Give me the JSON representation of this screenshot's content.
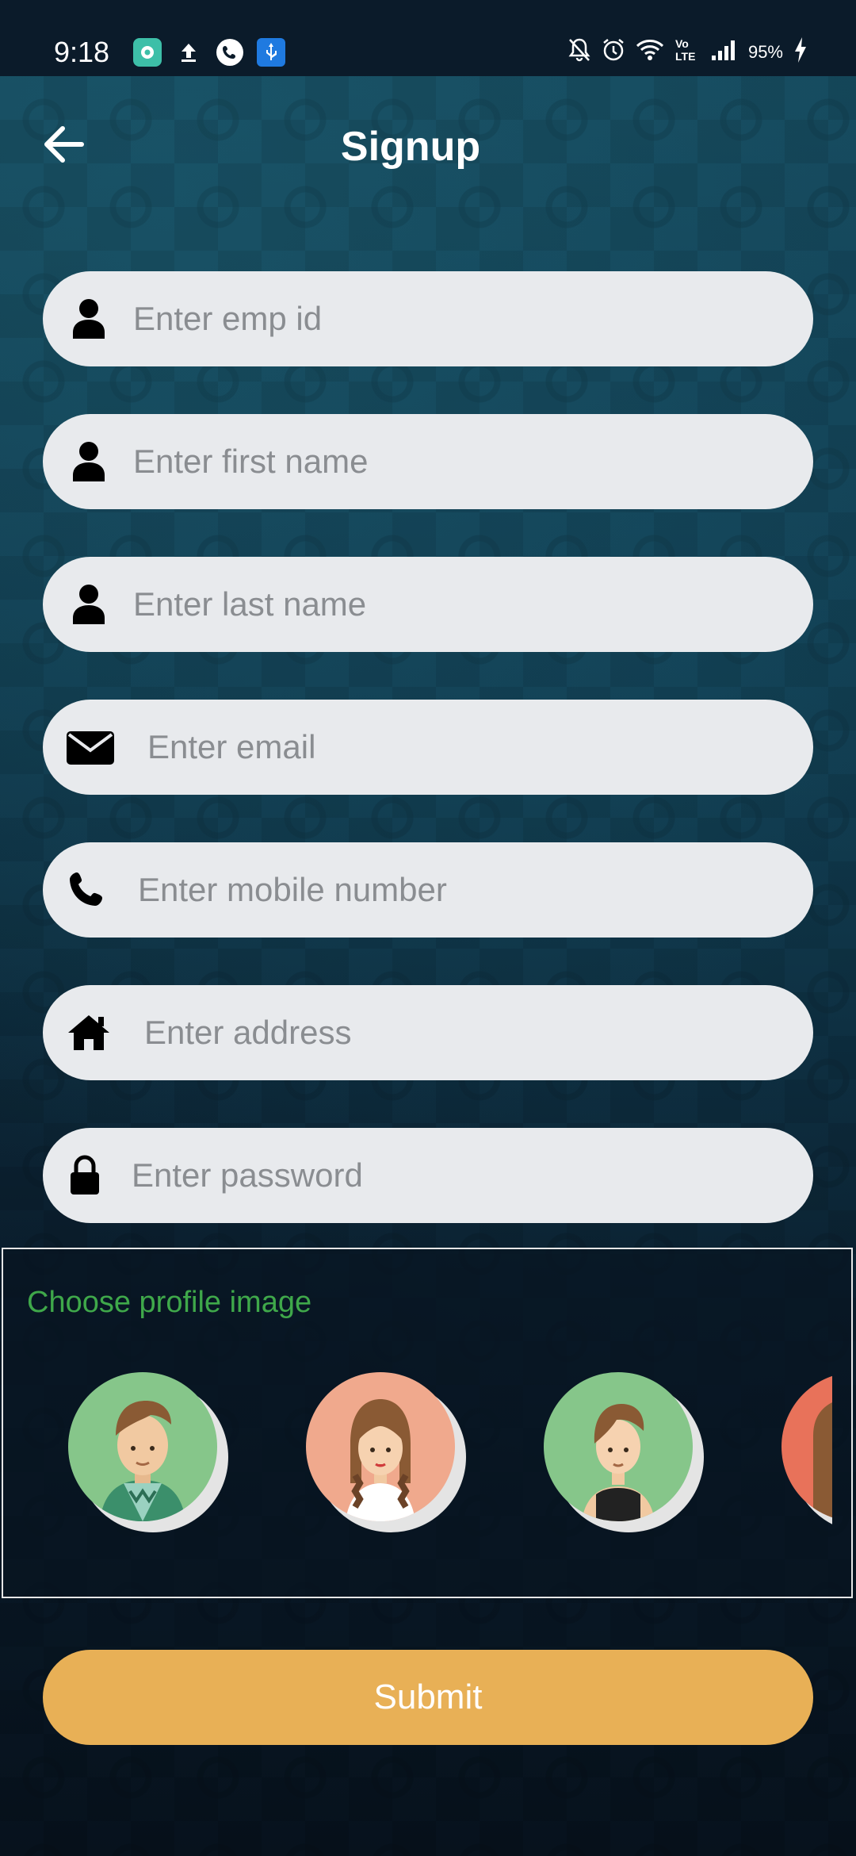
{
  "status_bar": {
    "time": "9:18",
    "battery": "95%",
    "icons_left": [
      "app-icon",
      "upload-icon",
      "phone-call-icon",
      "usb-icon"
    ],
    "icons_right": [
      "bell-off-icon",
      "alarm-icon",
      "wifi-icon",
      "volte-icon",
      "signal-icon",
      "battery-charging-icon"
    ]
  },
  "header": {
    "title": "Signup",
    "back_icon": "arrow-left-icon"
  },
  "form": {
    "emp_id": {
      "placeholder": "Enter emp id",
      "value": "",
      "icon": "person-icon"
    },
    "first_name": {
      "placeholder": "Enter first name",
      "value": "",
      "icon": "person-icon"
    },
    "last_name": {
      "placeholder": "Enter last name",
      "value": "",
      "icon": "person-icon"
    },
    "email": {
      "placeholder": "Enter email",
      "value": "",
      "icon": "envelope-icon"
    },
    "mobile": {
      "placeholder": "Enter mobile number",
      "value": "",
      "icon": "phone-icon"
    },
    "address": {
      "placeholder": "Enter address",
      "value": "",
      "icon": "home-icon"
    },
    "password": {
      "placeholder": "Enter password",
      "value": "",
      "icon": "lock-icon"
    }
  },
  "profile": {
    "label": "Choose profile image",
    "avatars": [
      {
        "name": "male-avatar-sweater",
        "bg": "#86c68a"
      },
      {
        "name": "female-avatar-braids",
        "bg": "#f0a98d"
      },
      {
        "name": "female-avatar-short-hair",
        "bg": "#86c68a"
      },
      {
        "name": "avatar-partial",
        "bg": "#e8725a"
      }
    ]
  },
  "submit": {
    "label": "Submit",
    "color": "#e8b056"
  },
  "colors": {
    "accent_green": "#3fa84a",
    "field_bg": "#e8eaed",
    "placeholder": "#8a8d91"
  }
}
